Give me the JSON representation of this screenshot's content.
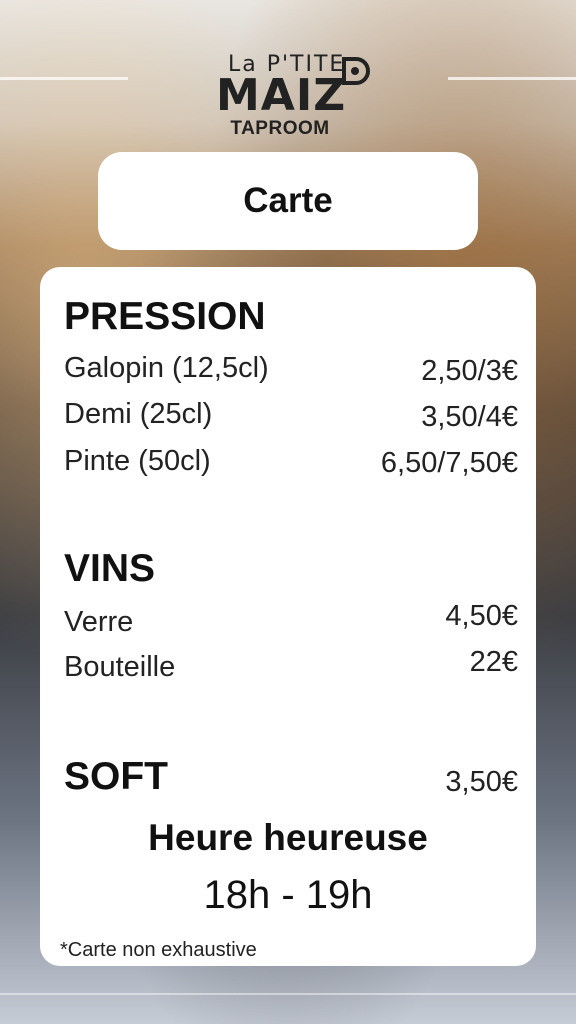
{
  "logo": {
    "small": "La P'TITE",
    "main": "MAIZ",
    "sub": "TAPROOM"
  },
  "title": "Carte",
  "sections": {
    "pression": {
      "title": "PRESSION",
      "items": [
        {
          "name": "Galopin (12,5cl)",
          "price": "2,50/3€"
        },
        {
          "name": "Demi (25cl)",
          "price": "3,50/4€"
        },
        {
          "name": "Pinte (50cl)",
          "price": "6,50/7,50€"
        }
      ]
    },
    "vins": {
      "title": "VINS",
      "items": [
        {
          "name": "Verre",
          "price": "4,50€"
        },
        {
          "name": "Bouteille",
          "price": "22€"
        }
      ]
    },
    "soft": {
      "title": "SOFT",
      "price": "3,50€"
    }
  },
  "happy_hour": {
    "title": "Heure heureuse",
    "time": "18h - 19h"
  },
  "footnote": "*Carte non exhaustive",
  "colors": {
    "card": "#ffffff",
    "text": "#111111"
  }
}
